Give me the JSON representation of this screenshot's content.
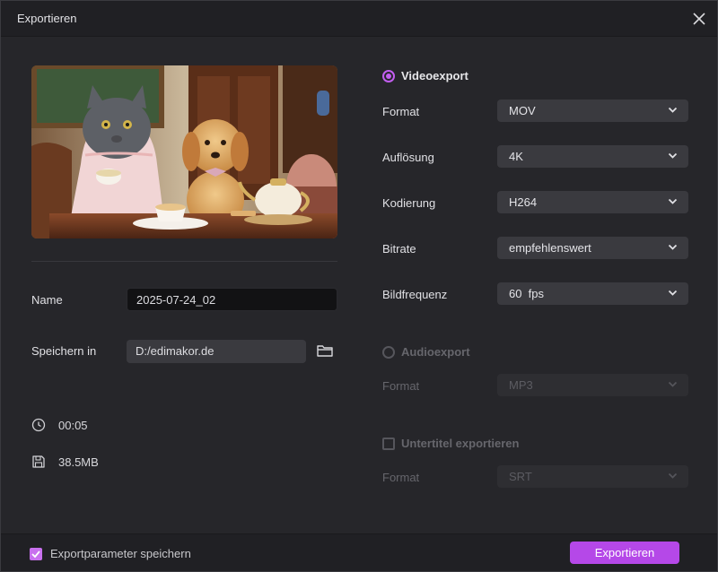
{
  "dialog": {
    "title": "Exportieren"
  },
  "left": {
    "name_label": "Name",
    "name_value": "2025-07-24_02",
    "save_label": "Speichern in",
    "save_path": "D:/edimakor.de",
    "duration": "00:05",
    "size": "38.5MB"
  },
  "video": {
    "heading": "Videoexport",
    "enabled": true,
    "rows": [
      {
        "label": "Format",
        "value": "MOV"
      },
      {
        "label": "Auflösung",
        "value": "4K"
      },
      {
        "label": "Kodierung",
        "value": "H264"
      },
      {
        "label": "Bitrate",
        "value": "empfehlenswert"
      },
      {
        "label": "Bildfrequenz",
        "value": "60  fps"
      }
    ]
  },
  "audio": {
    "heading": "Audioexport",
    "enabled": false,
    "format_label": "Format",
    "format_value": "MP3"
  },
  "subtitle": {
    "heading": "Untertitel exportieren",
    "enabled": false,
    "format_label": "Format",
    "format_value": "SRT"
  },
  "footer": {
    "save_params_label": "Exportparameter speichern",
    "save_params_checked": true,
    "export_label": "Exportieren"
  },
  "colors": {
    "accent": "#b548e8",
    "background": "#26262a",
    "field": "#3a3a3f"
  }
}
